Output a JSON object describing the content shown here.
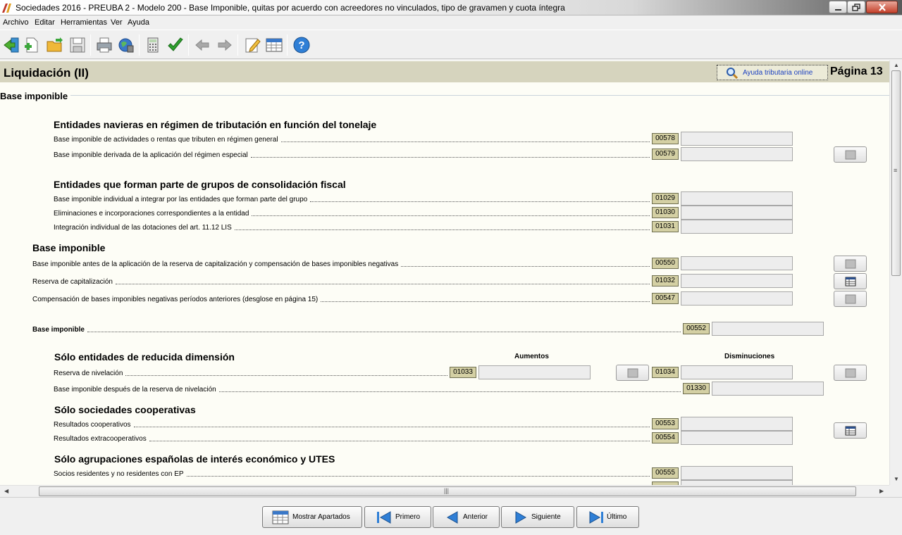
{
  "window": {
    "title": "Sociedades 2016 - PREUBA 2 - Modelo 200 - Base Imponible, quitas por acuerdo con acreedores no vinculados, tipo de gravamen y cuota íntegra"
  },
  "menu": [
    "Archivo",
    "Editar",
    "Herramientas",
    "Ver",
    "Ayuda"
  ],
  "page": {
    "title": "Liquidación (II)",
    "help_link": "Ayuda tributaria online",
    "page_number": "Página 13",
    "section": "Base imponible"
  },
  "groups": {
    "navieras": {
      "title": "Entidades navieras en régimen de tributación en función del tonelaje",
      "rows": [
        {
          "label": "Base imponible de actividades o rentas que tributen en régimen general",
          "code": "00578",
          "value": ""
        },
        {
          "label": "Base imponible derivada de la aplicación del régimen especial",
          "code": "00579",
          "value": ""
        }
      ]
    },
    "grupos": {
      "title": "Entidades que forman parte de grupos de consolidación fiscal",
      "rows": [
        {
          "label": "Base imponible individual a integrar por las entidades que forman parte del grupo",
          "code": "01029",
          "value": ""
        },
        {
          "label": "Eliminaciones e incorporaciones correspondientes a la entidad",
          "code": "01030",
          "value": ""
        },
        {
          "label": "Integración individual de las dotaciones del art. 11.12 LIS",
          "code": "01031",
          "value": ""
        }
      ]
    },
    "base": {
      "title": "Base imponible",
      "rows": [
        {
          "label": "Base imponible antes de la aplicación de la reserva de capitalización y compensación de bases imponibles negativas",
          "code": "00550",
          "value": ""
        },
        {
          "label": "Reserva de capitalización",
          "code": "01032",
          "value": ""
        },
        {
          "label": "Compensación de bases imponibles negativas períodos anteriores (desglose en página 15)",
          "code": "00547",
          "value": ""
        }
      ],
      "total": {
        "label": "Base imponible",
        "code": "00552",
        "value": ""
      }
    },
    "reducida": {
      "title": "Sólo entidades de reducida dimensión",
      "col_aumentos": "Aumentos",
      "col_disminuciones": "Disminuciones",
      "reserva": {
        "label": "Reserva de nivelación",
        "code_aumentos": "01033",
        "code_disminuciones": "01034"
      },
      "despues": {
        "label": "Base imponible después de la reserva de nivelación",
        "code": "01330"
      }
    },
    "cooperativas": {
      "title": "Sólo sociedades cooperativas",
      "rows": [
        {
          "label": "Resultados cooperativos",
          "code": "00553",
          "value": ""
        },
        {
          "label": "Resultados extracooperativos",
          "code": "00554",
          "value": ""
        }
      ]
    },
    "agrupaciones": {
      "title": "Sólo agrupaciones españolas de interés económico y UTES",
      "rows": [
        {
          "label": "Socios residentes y no residentes con EP",
          "code": "00555",
          "value": ""
        }
      ]
    }
  },
  "nav": {
    "mostrar": "Mostrar Apartados",
    "primero": "Primero",
    "anterior": "Anterior",
    "siguiente": "Siguiente",
    "ultimo": "Último"
  },
  "colors": {
    "header_bg": "#d6d4be",
    "content_bg": "#fdfdf6",
    "code_bg": "#d4d0a4",
    "link": "#1a3fc0"
  }
}
